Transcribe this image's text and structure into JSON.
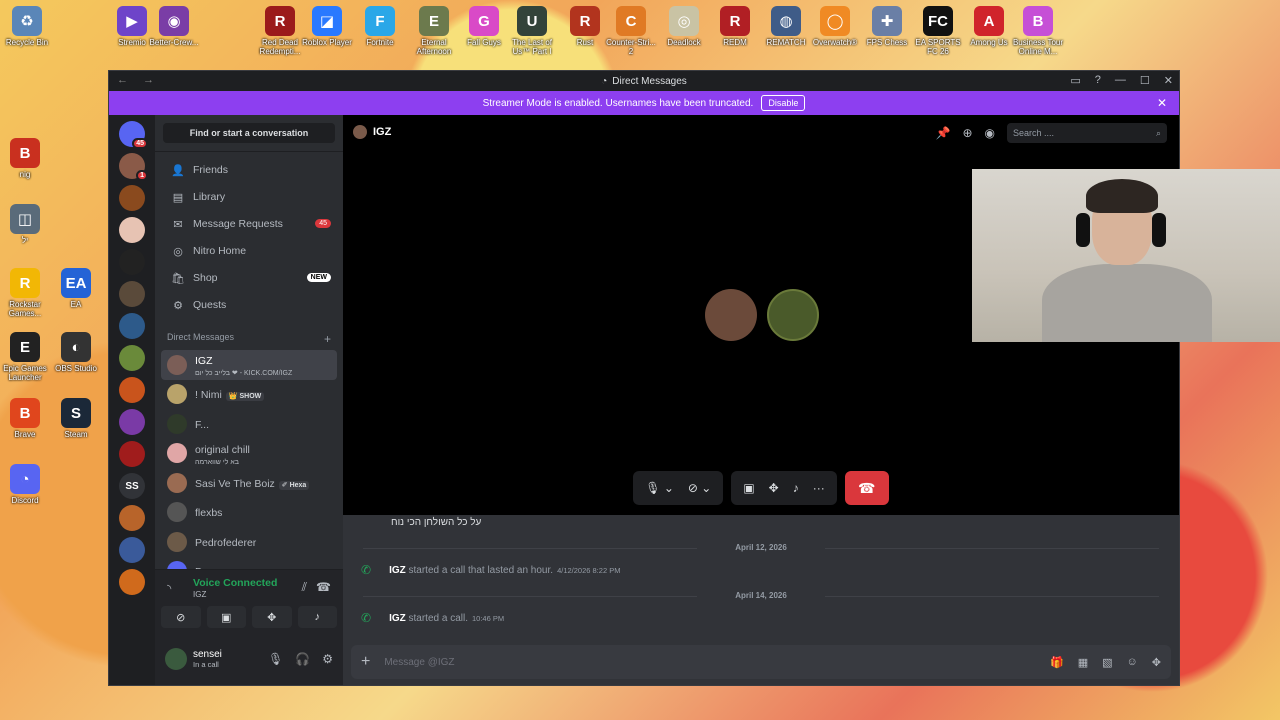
{
  "desktop": {
    "top_icons": [
      {
        "label": "Recycle Bin",
        "color": "#5a86b8",
        "glyph": "♻"
      },
      {
        "label": "Stremio",
        "color": "#6e44c9",
        "glyph": "▶"
      },
      {
        "label": "Better-Crew...",
        "color": "#7a3da6",
        "glyph": "◉"
      },
      {
        "label": "Red Dead Redempti...",
        "color": "#9b1b1b",
        "glyph": "R"
      },
      {
        "label": "Roblox Player",
        "color": "#2979ff",
        "glyph": "◪"
      },
      {
        "label": "Fortnite",
        "color": "#2aa7e8",
        "glyph": "F"
      },
      {
        "label": "Eternal Afternoon",
        "color": "#6c7a4d",
        "glyph": "E"
      },
      {
        "label": "Fall Guys",
        "color": "#d94ac7",
        "glyph": "G"
      },
      {
        "label": "The Last of Us™ Part I",
        "color": "#33433a",
        "glyph": "U"
      },
      {
        "label": "Rust",
        "color": "#b2341e",
        "glyph": "R"
      },
      {
        "label": "Counter-Stri... 2",
        "color": "#e07a24",
        "glyph": "C"
      },
      {
        "label": "Deadlock",
        "color": "#c9c3a4",
        "glyph": "◎"
      },
      {
        "label": "REDM",
        "color": "#b11f24",
        "glyph": "R"
      },
      {
        "label": "REMATCH",
        "color": "#3f5c88",
        "glyph": "◍"
      },
      {
        "label": "Overwatch®",
        "color": "#f08a24",
        "glyph": "◯"
      },
      {
        "label": "FPS Chess",
        "color": "#6a7fa6",
        "glyph": "✚"
      },
      {
        "label": "EA SPORTS FC 26",
        "color": "#111111",
        "glyph": "FC"
      },
      {
        "label": "Among Us",
        "color": "#d0242b",
        "glyph": "A"
      },
      {
        "label": "Business Tour Online M...",
        "color": "#c64fd6",
        "glyph": "B"
      }
    ],
    "left_icons": [
      {
        "label": "nig",
        "color": "#c9301f",
        "glyph": "B"
      },
      {
        "label": "יל",
        "color": "#5a6b7a",
        "glyph": "◫"
      },
      {
        "label": "Rockstar Games...",
        "color": "#f2b705",
        "glyph": "R"
      },
      {
        "label": "EA",
        "color": "#2463d6",
        "glyph": "EA"
      },
      {
        "label": "Epic Games Launcher",
        "color": "#222222",
        "glyph": "E"
      },
      {
        "label": "OBS Studio",
        "color": "#333333",
        "glyph": "◐"
      },
      {
        "label": "Brave",
        "color": "#e0461d",
        "glyph": "B"
      },
      {
        "label": "Steam",
        "color": "#1b2838",
        "glyph": "S"
      },
      {
        "label": "Discord",
        "color": "#5865f2",
        "glyph": "◔"
      }
    ]
  },
  "window": {
    "title": "Direct Messages",
    "back_forward": "← →",
    "banner_text": "Streamer Mode is enabled. Usernames have been truncated.",
    "banner_button": "Disable"
  },
  "sidebar": {
    "search_label": "Find or start a conversation",
    "nav": [
      {
        "label": "Friends",
        "icon": "friends-icon",
        "glyph": "👤",
        "pill": ""
      },
      {
        "label": "Library",
        "icon": "library-icon",
        "glyph": "▤",
        "pill": ""
      },
      {
        "label": "Message Requests",
        "icon": "mail-icon",
        "glyph": "✉",
        "pill": "45"
      },
      {
        "label": "Nitro Home",
        "icon": "nitro-icon",
        "glyph": "◎",
        "pill": ""
      },
      {
        "label": "Shop",
        "icon": "shop-icon",
        "glyph": "🛍",
        "pill": "NEW"
      },
      {
        "label": "Quests",
        "icon": "quests-icon",
        "glyph": "⚙",
        "pill": ""
      }
    ],
    "dm_header": "Direct Messages",
    "dms": [
      {
        "name": "IGZ",
        "sub": "בלייב כל יום ❤ - KICK.COM/IGZ",
        "tag": "",
        "color": "#7b5e57"
      },
      {
        "name": "! Nimi",
        "sub": "",
        "tag": "👑 SHOW",
        "color": "#b9a36a"
      },
      {
        "name": "F...",
        "sub": "",
        "tag": "",
        "color": "#2f3a2a"
      },
      {
        "name": "original chill",
        "sub": "בא לי שווארמה",
        "tag": "",
        "color": "#e0a6a6"
      },
      {
        "name": "Sasi Ve The Boiz",
        "sub": "",
        "tag": "✐ Hexa",
        "color": "#9a6b52"
      },
      {
        "name": "flexbs",
        "sub": "",
        "tag": "",
        "color": "#555555"
      },
      {
        "name": "Pedrofederer",
        "sub": "",
        "tag": "",
        "color": "#6c5a48"
      },
      {
        "name": "Dangoor",
        "sub": "",
        "tag": "",
        "color": "#5865f2"
      }
    ],
    "voice_status": "Voice Connected",
    "voice_channel": "IGZ",
    "user_name": "sensei",
    "user_status": "In a call"
  },
  "servers": [
    {
      "color": "#5865f2",
      "label": "",
      "badge": "45"
    },
    {
      "color": "#8a5a48",
      "label": "",
      "badge": "1"
    },
    {
      "color": "#8a4a1e",
      "label": "",
      "badge": ""
    },
    {
      "color": "#e7c3b3",
      "label": "",
      "badge": ""
    },
    {
      "color": "#222222",
      "label": "",
      "badge": ""
    },
    {
      "color": "#5a4a3a",
      "label": "",
      "badge": ""
    },
    {
      "color": "#2d5a8a",
      "label": "",
      "badge": ""
    },
    {
      "color": "#6a8a3a",
      "label": "",
      "badge": ""
    },
    {
      "color": "#c9541c",
      "label": "",
      "badge": ""
    },
    {
      "color": "#7a3aa6",
      "label": "",
      "badge": ""
    },
    {
      "color": "#a01c1c",
      "label": "",
      "badge": ""
    },
    {
      "color": "#313338",
      "label": "SS",
      "badge": ""
    },
    {
      "color": "#b8642a",
      "label": "",
      "badge": ""
    },
    {
      "color": "#3a5a9a",
      "label": "",
      "badge": ""
    },
    {
      "color": "#d06a1c",
      "label": "",
      "badge": ""
    }
  ],
  "call": {
    "name": "IGZ",
    "search_placeholder": "Search ....",
    "participants": [
      {
        "color": "#6b4a3a"
      },
      {
        "color": "#4a5a2a"
      }
    ]
  },
  "messages": {
    "top_text": "על כל השולחן הכי נוח",
    "date1": "April 12, 2026",
    "call1_user": "IGZ",
    "call1_text": "started a call that lasted an hour.",
    "call1_time": "4/12/2026 8:22 PM",
    "date2": "April 14, 2026",
    "call2_user": "IGZ",
    "call2_text": "started a call.",
    "call2_time": "10:46 PM",
    "composer_placeholder": "Message @IGZ"
  }
}
